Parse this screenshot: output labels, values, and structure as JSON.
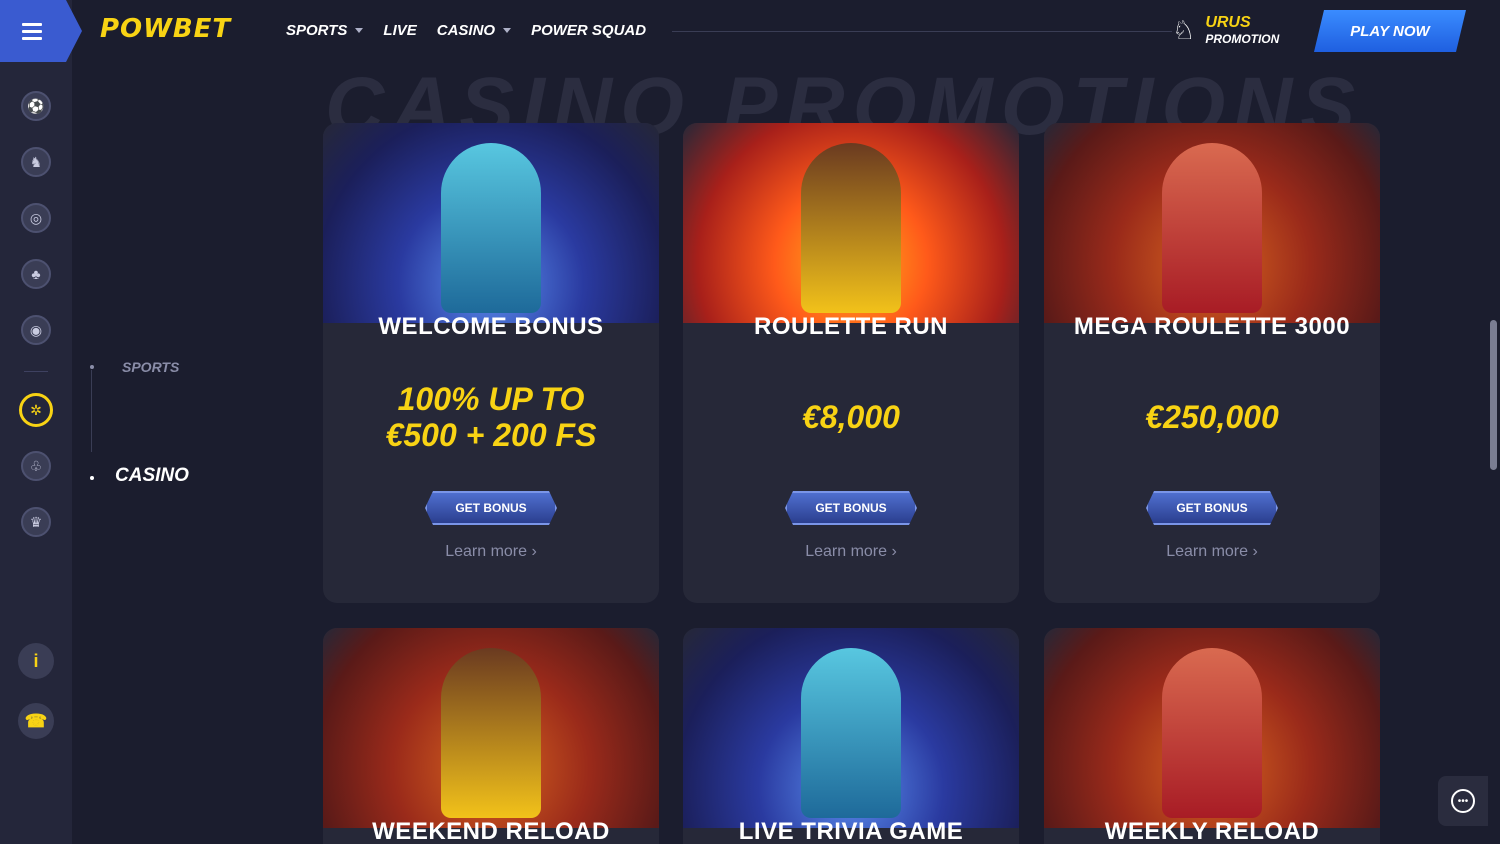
{
  "brand": {
    "logo_text": "POWBET"
  },
  "nav": {
    "items": [
      {
        "label": "SPORTS",
        "dropdown": true
      },
      {
        "label": "LIVE",
        "dropdown": false
      },
      {
        "label": "CASINO",
        "dropdown": true
      },
      {
        "label": "POWER SQUAD",
        "dropdown": false
      }
    ],
    "promo_line1": "URUS",
    "promo_line2": "PROMOTION",
    "play_now": "PLAY NOW"
  },
  "sidebar": {
    "icons": [
      "soccer-icon",
      "horse-racing-icon",
      "esports-icon",
      "cards-icon",
      "live-stream-icon",
      "roulette-icon",
      "poker-chips-icon",
      "trophy-icon"
    ],
    "active_icon": "roulette-icon",
    "info_glyph": "i",
    "support_glyph": "☎"
  },
  "submenu": {
    "sports": "SPORTS",
    "casino": "CASINO"
  },
  "page": {
    "title": "CASINO PROMOTIONS"
  },
  "cards": [
    {
      "title": "WELCOME BONUS",
      "value_line1": "100% UP TO",
      "value_line2": "€500 + 200 FS",
      "button": "GET BONUS",
      "link": "Learn more ›"
    },
    {
      "title": "ROULETTE RUN",
      "value_line1": "€8,000",
      "value_line2": "",
      "button": "GET BONUS",
      "link": "Learn more ›"
    },
    {
      "title": "MEGA ROULETTE 3000",
      "value_line1": "€250,000",
      "value_line2": "",
      "button": "GET BONUS",
      "link": "Learn more ›"
    },
    {
      "title": "WEEKEND RELOAD"
    },
    {
      "title": "LIVE TRIVIA GAME"
    },
    {
      "title": "WEEKLY RELOAD"
    }
  ],
  "colors": {
    "accent": "#f8d314",
    "primary": "#3a5bd0",
    "bg": "#1b1d2e",
    "card": "#262838"
  }
}
